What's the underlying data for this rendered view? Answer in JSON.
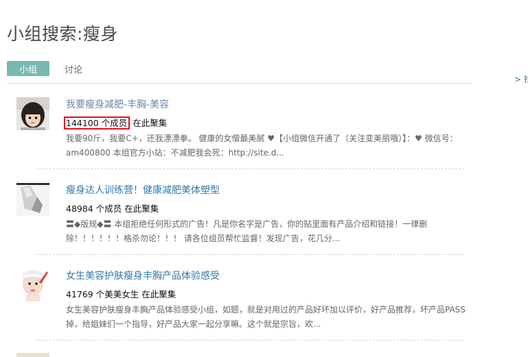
{
  "page": {
    "title": "小组搜索:瘦身"
  },
  "tabs": [
    {
      "label": "小组",
      "active": true
    },
    {
      "label": "讨论",
      "active": false
    }
  ],
  "side_link": "> 找",
  "results": [
    {
      "title": "我要瘦身减肥-丰胸-美容",
      "members": "144100 个成员",
      "gather": "在此聚集",
      "desc": "我要90斤，我要C+，还我漂漂拳。 健康的女僧最美腻 ♥【小组微信开通了（关注变美丽哦）】：♥ 微信号：am400800 本组官方小站：不减肥我会死：http://site.d..."
    },
    {
      "title": "瘦身达人训练营！健康减肥美体塑型",
      "members": "48984 个成员",
      "gather": "在此聚集",
      "desc": "〓◆版规◆〓 本组拒绝任何形式的广告！凡是你名字是广告，你的贴里面有产品介绍和链接！一律删除！！！！！！格杀勿论！！！ 请各位组员帮忙监督！发现广告，花几分..."
    },
    {
      "title": "女生美容护肤瘦身丰胸产品体验感受",
      "members": "41769 个美美女生",
      "gather": "在此聚集",
      "desc": "女生美容护肤瘦身丰胸产品体验感受小组，如题，就是对用过的产品好坏加以评价，好产品推荐，坏产品PASS掉，给姐妹们一个指导，好产品大家一起分享嘛。这个就是宗旨，欢..."
    }
  ],
  "colors": {
    "link": "#3377aa",
    "tab_active": "#78b8b3",
    "highlight_box": "#e3101e"
  }
}
